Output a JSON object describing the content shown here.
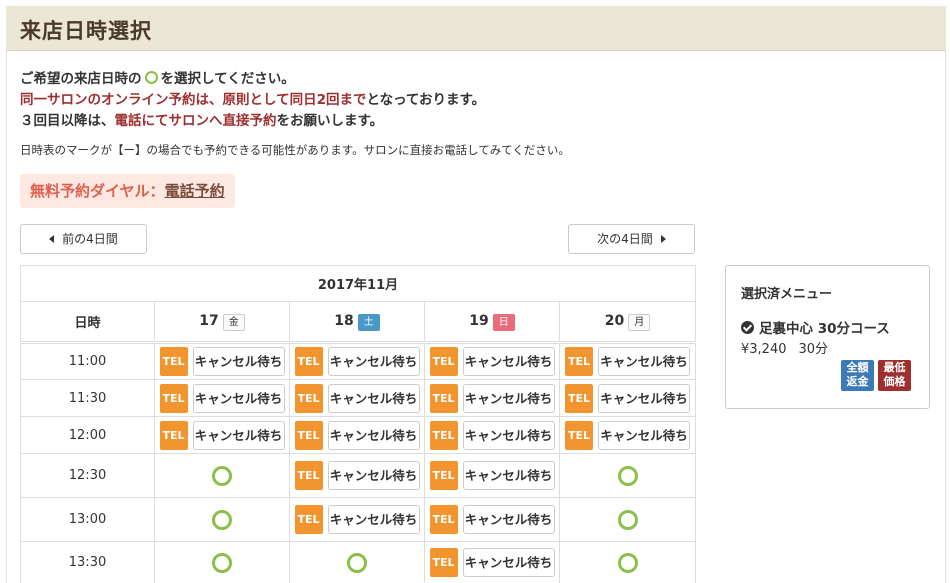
{
  "page": {
    "title": "来店日時選択"
  },
  "intro": {
    "line1_a": "ご希望の来店日時の",
    "line1_b": "を選択してください。",
    "line2_a": "同一サロンのオンライン予約は、原則として同日2回まで",
    "line2_b": "となっております。",
    "line3_a": "３回目以降は、",
    "line3_b": "電話にてサロンへ直接予約",
    "line3_c": "をお願いします。"
  },
  "note": "日時表のマークが【ー】の場合でも予約できる可能性があります。サロンに直接お電話してみてください。",
  "dial": {
    "label": "無料予約ダイヤル：",
    "link": "電話予約"
  },
  "nav": {
    "prev": "前の4日間",
    "next": "次の4日間"
  },
  "schedule": {
    "month": "2017年11月",
    "time_header": "日時",
    "days": [
      {
        "date": "17",
        "weekday": "金",
        "type": "weekday"
      },
      {
        "date": "18",
        "weekday": "土",
        "type": "sat"
      },
      {
        "date": "19",
        "weekday": "日",
        "type": "sun"
      },
      {
        "date": "20",
        "weekday": "月",
        "type": "weekday"
      }
    ],
    "tel_label": "TEL",
    "cancel_label": "キャンセル待ち",
    "rows": [
      {
        "time": "11:00",
        "slots": [
          "tel",
          "tel",
          "tel",
          "tel"
        ]
      },
      {
        "time": "11:30",
        "slots": [
          "tel",
          "tel",
          "tel",
          "tel"
        ]
      },
      {
        "time": "12:00",
        "slots": [
          "tel",
          "tel",
          "tel",
          "tel"
        ]
      },
      {
        "time": "12:30",
        "slots": [
          "available",
          "tel",
          "tel",
          "available"
        ]
      },
      {
        "time": "13:00",
        "slots": [
          "available",
          "tel",
          "tel",
          "available"
        ]
      },
      {
        "time": "13:30",
        "slots": [
          "available",
          "available",
          "tel",
          "available"
        ]
      }
    ]
  },
  "selected_menu": {
    "title": "選択済メニュー",
    "course": "足裏中心 30分コース",
    "price": "¥3,240",
    "duration": "30分",
    "badges": [
      "全額\n返金",
      "最低\n価格"
    ]
  },
  "colors": {
    "header_bg": "#ebe6d5",
    "accent_red": "#9e2f2f",
    "tel_orange": "#f2952f",
    "available_green": "#8cbf4a",
    "saturday_blue": "#4a98c8",
    "sunday_pink": "#ea6b7a"
  }
}
